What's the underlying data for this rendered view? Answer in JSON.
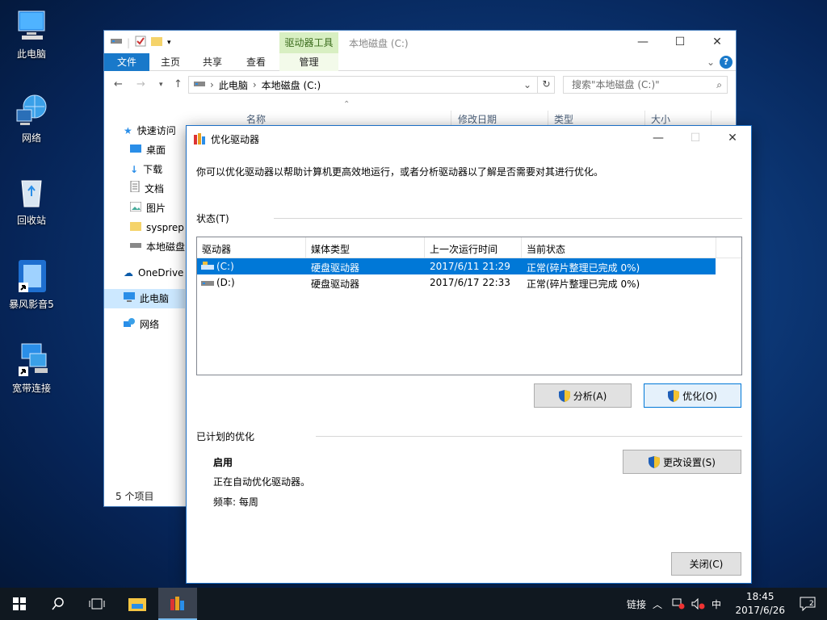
{
  "desktop": {
    "icons": [
      {
        "label": "此电脑"
      },
      {
        "label": "网络"
      },
      {
        "label": "回收站"
      },
      {
        "label": "暴风影音5"
      },
      {
        "label": "宽带连接"
      }
    ]
  },
  "explorer": {
    "context_tab": "驱动器工具",
    "title": "本地磁盘 (C:)",
    "ribbon_tabs": {
      "file": "文件",
      "home": "主页",
      "share": "共享",
      "view": "查看",
      "manage": "管理"
    },
    "breadcrumb": {
      "root": "此电脑",
      "current": "本地磁盘 (C:)"
    },
    "search_placeholder": "搜索\"本地磁盘 (C:)\"",
    "columns": {
      "name": "名称",
      "modified": "修改日期",
      "type": "类型",
      "size": "大小"
    },
    "nav": {
      "quick_access": "快速访问",
      "desktop": "桌面",
      "downloads": "下载",
      "documents": "文档",
      "pictures": "图片",
      "sysprep": "sysprep",
      "local_disk": "本地磁盘",
      "onedrive": "OneDrive",
      "this_pc": "此电脑",
      "network": "网络"
    },
    "status": "5 个项目"
  },
  "dialog": {
    "title": "优化驱动器",
    "description": "你可以优化驱动器以帮助计算机更高效地运行，或者分析驱动器以了解是否需要对其进行优化。",
    "status_label": "状态(T)",
    "columns": {
      "drive": "驱动器",
      "media": "媒体类型",
      "last_run": "上一次运行时间",
      "state": "当前状态"
    },
    "drives": [
      {
        "drive": "(C:)",
        "media": "硬盘驱动器",
        "last_run": "2017/6/11 21:29",
        "state": "正常(碎片整理已完成 0%)"
      },
      {
        "drive": "(D:)",
        "media": "硬盘驱动器",
        "last_run": "2017/6/17 22:33",
        "state": "正常(碎片整理已完成 0%)"
      }
    ],
    "analyze_button": "分析(A)",
    "optimize_button": "优化(O)",
    "scheduled_label": "已计划的优化",
    "schedule_state": "启用",
    "schedule_desc": "正在自动优化驱动器。",
    "frequency": "频率: 每周",
    "change_settings_button": "更改设置(S)",
    "close_button": "关闭(C)"
  },
  "taskbar": {
    "links_label": "链接",
    "ime": "中",
    "time": "18:45",
    "date": "2017/6/26",
    "notification_badge": "2"
  },
  "colors": {
    "accent": "#0078d7",
    "file_tab": "#1979ca",
    "drive_tools_tab": "#d8efc2"
  }
}
